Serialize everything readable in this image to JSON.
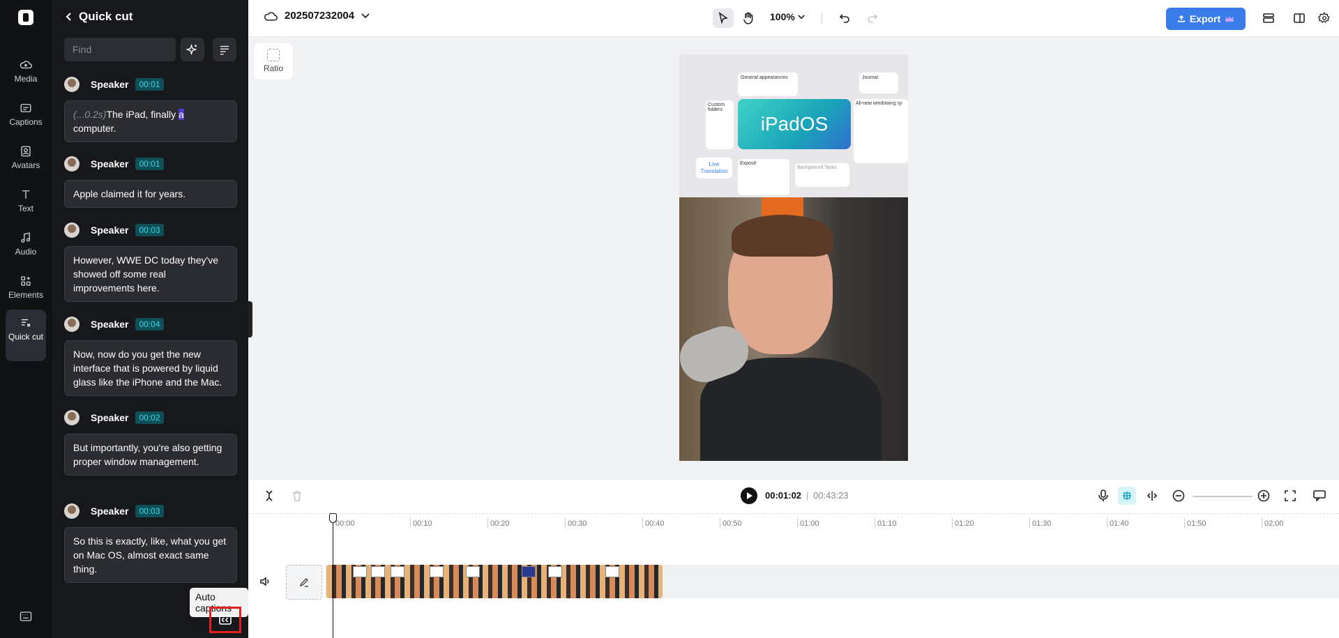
{
  "rail": {
    "items": [
      {
        "label": "Media",
        "icon": "cloud-upload-icon"
      },
      {
        "label": "Captions",
        "icon": "captions-icon"
      },
      {
        "label": "Avatars",
        "icon": "avatar-icon"
      },
      {
        "label": "Text",
        "icon": "text-icon"
      },
      {
        "label": "Audio",
        "icon": "music-icon"
      },
      {
        "label": "Elements",
        "icon": "elements-icon"
      },
      {
        "label": "Quick cut",
        "icon": "quick-cut-icon",
        "active": true
      }
    ]
  },
  "panel": {
    "title": "Quick cut",
    "find_placeholder": "Find",
    "segments": [
      {
        "speaker": "Speaker",
        "time": "00:01",
        "pause": "(...0.2s)",
        "text_before": "The iPad, finally ",
        "highlight": "a",
        "text_after": " computer."
      },
      {
        "speaker": "Speaker",
        "time": "00:01",
        "text": "Apple claimed it for years."
      },
      {
        "speaker": "Speaker",
        "time": "00:03",
        "text": "However, WWE DC today they've showed off some real improvements here."
      },
      {
        "speaker": "Speaker",
        "time": "00:04",
        "text": "Now, now do you get the new interface that is powered by liquid glass like the iPhone and the Mac."
      },
      {
        "speaker": "Speaker",
        "time": "00:02",
        "text": "But importantly, you're also getting proper window management."
      },
      {
        "speaker": "Speaker",
        "time": "00:03",
        "text": "So this is exactly, like, what you get on Mac OS, almost exact same thing."
      }
    ],
    "tooltip": "Auto captions"
  },
  "topbar": {
    "project_name": "202507232004",
    "zoom": "100%",
    "export_label": "Export"
  },
  "canvas": {
    "ratio_label": "Ratio",
    "video": {
      "ipados": "iPadOS",
      "live_translation": "Live Translation",
      "card_general": "General appearances",
      "card_custom": "Custom folders",
      "card_journal": "Journal",
      "card_windowing": "All-new windowing sy",
      "card_expose": "Exposé",
      "card_background": "Background Tasks"
    }
  },
  "timeline": {
    "current_time": "00:01:02",
    "separator": "|",
    "total_time": "00:43:23",
    "ruler": [
      "00:00",
      "00:10",
      "00:20",
      "00:30",
      "00:40",
      "00:50",
      "01:00",
      "01:10",
      "01:20",
      "01:30",
      "01:40",
      "01:50",
      "02:00"
    ]
  }
}
